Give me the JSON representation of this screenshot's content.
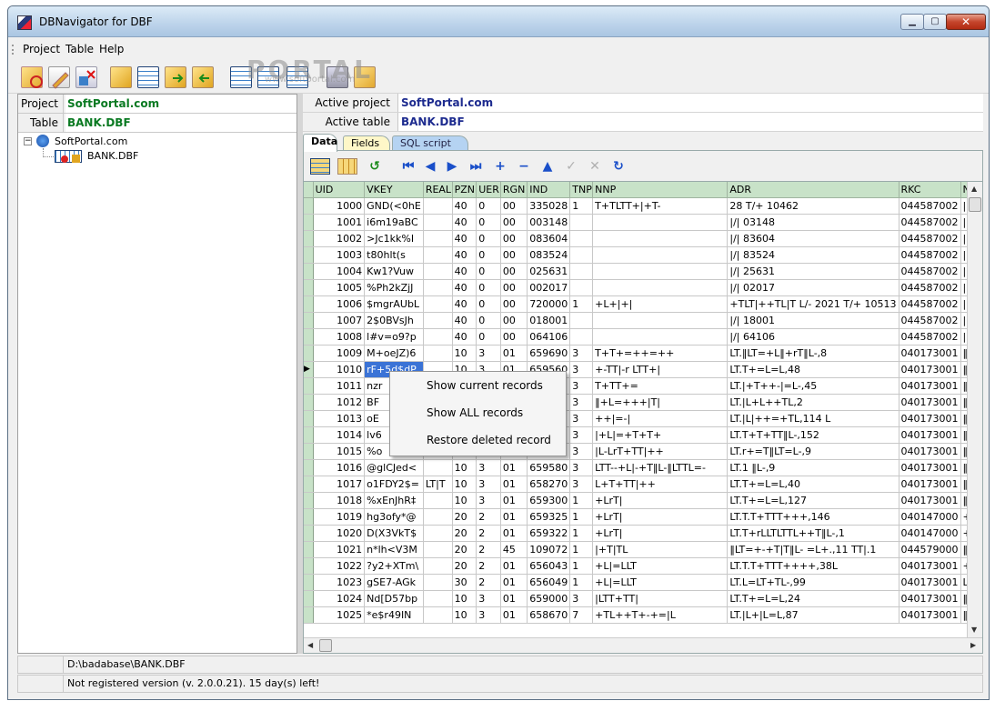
{
  "window": {
    "title": "DBNavigator for DBF"
  },
  "menu": [
    "Project",
    "Table",
    "Help"
  ],
  "watermark": {
    "big": "PORTAL",
    "small": "www.softportal.com"
  },
  "left": {
    "project_label": "Project",
    "project_value": "SoftPortal.com",
    "table_label": "Table",
    "table_value": "BANK.DBF",
    "tree": {
      "root": "SoftPortal.com",
      "child": "BANK.DBF"
    }
  },
  "right": {
    "active_project_label": "Active project",
    "active_project_value": "SoftPortal.com",
    "active_table_label": "Active table",
    "active_table_value": "BANK.DBF",
    "tabs": [
      "Data",
      "Fields",
      "SQL script"
    ]
  },
  "grid": {
    "columns": [
      "UID",
      "VKEY",
      "REAL",
      "PZN",
      "UER",
      "RGN",
      "IND",
      "TNP",
      "NNP",
      "ADR",
      "RKC",
      "NA"
    ],
    "rows": [
      [
        "1000",
        "GND(<0hE",
        "",
        "40",
        "0",
        "00",
        "335028",
        "1",
        "T+TLTT+|+T-",
        "28 T/+ 10462",
        "044587002",
        "|L"
      ],
      [
        "1001",
        "i6m19aBC",
        "",
        "40",
        "0",
        "00",
        "003148",
        "",
        "",
        "|/| 03148",
        "044587002",
        "|L"
      ],
      [
        "1002",
        ">Jc1kk%I",
        "",
        "40",
        "0",
        "00",
        "083604",
        "",
        "",
        "|/| 83604",
        "044587002",
        "|L"
      ],
      [
        "1003",
        "t80hlt(s",
        "",
        "40",
        "0",
        "00",
        "083524",
        "",
        "",
        "|/| 83524",
        "044587002",
        "|L"
      ],
      [
        "1004",
        "Kw1?Vuw",
        "",
        "40",
        "0",
        "00",
        "025631",
        "",
        "",
        "|/| 25631",
        "044587002",
        "|L"
      ],
      [
        "1005",
        "%Ph2kZjJ",
        "",
        "40",
        "0",
        "00",
        "002017",
        "",
        "",
        "|/| 02017",
        "044587002",
        "|L"
      ],
      [
        "1006",
        "$mgrAUbL",
        "",
        "40",
        "0",
        "00",
        "720000",
        "1",
        "+L+|+|",
        "+TLT|++TL|T L/- 2021 T/+ 10513",
        "044587002",
        "|L"
      ],
      [
        "1007",
        "2$0BVsJh",
        "",
        "40",
        "0",
        "00",
        "018001",
        "",
        "",
        "|/| 18001",
        "044587002",
        "|L"
      ],
      [
        "1008",
        "l#v=o9?p",
        "",
        "40",
        "0",
        "00",
        "064106",
        "",
        "",
        "|/| 64106",
        "044587002",
        "|L"
      ],
      [
        "1009",
        "M+oeJZ)6",
        "",
        "10",
        "3",
        "01",
        "659690",
        "3",
        "T+T+=++=++",
        "LT.‖LT=+L‖+rT‖L-,8",
        "040173001",
        "‖r"
      ],
      [
        "1010",
        "rF+5d$dP",
        "",
        "10",
        "3",
        "01",
        "659560",
        "3",
        "+-TT|-r LTT+|",
        "LT.T+=L=L,48",
        "040173001",
        "‖r"
      ],
      [
        "1011",
        "nzr",
        "",
        "",
        "",
        "",
        "",
        "3",
        "T+TT+=",
        "LT.|+T++-|=L-,45",
        "040173001",
        "‖r"
      ],
      [
        "1012",
        "BF",
        "",
        "",
        "",
        "",
        "",
        "3",
        "‖+L=+++|T|",
        "LT.|L+L++TL,2",
        "040173001",
        "‖r"
      ],
      [
        "1013",
        "oE",
        "",
        "",
        "",
        "",
        "",
        "3",
        "++|=-|",
        "LT.|L|++=+TL,114 L",
        "040173001",
        "‖r"
      ],
      [
        "1014",
        "lv6",
        "",
        "",
        "",
        "",
        "",
        "3",
        "|+L|=+T+T+",
        "LT.T+T+TT‖L-,152",
        "040173001",
        "‖r"
      ],
      [
        "1015",
        "%o",
        "",
        "",
        "",
        "",
        "",
        "3",
        "|L-LrT+TT|++",
        "LT.r+=T‖LT=L-,9",
        "040173001",
        "‖r"
      ],
      [
        "1016",
        "@glCJed<",
        "",
        "10",
        "3",
        "01",
        "659580",
        "3",
        "LTT--+L|-+T‖L-‖LTTL=-",
        "LT.1 ‖L-,9",
        "040173001",
        "‖r"
      ],
      [
        "1017",
        "o1FDY2$=",
        "LT|T",
        "10",
        "3",
        "01",
        "658270",
        "3",
        "L+T+TT|++",
        "LT.T+=L=L,40",
        "040173001",
        "‖r"
      ],
      [
        "1018",
        "%xEnJhR‡",
        "",
        "10",
        "3",
        "01",
        "659300",
        "1",
        "+LrT|",
        "LT.T+=L=L,127",
        "040173001",
        "‖r"
      ],
      [
        "1019",
        "hg3ofy*@",
        "",
        "20",
        "2",
        "01",
        "659325",
        "1",
        "+LrT|",
        "LT.T.T+TTT+++,146",
        "040147000",
        "+L"
      ],
      [
        "1020",
        "D(X3VkT$",
        "",
        "20",
        "2",
        "01",
        "659322",
        "1",
        "+LrT|",
        "LT.T+rLLTLTTL++T‖L-,1",
        "040147000",
        "+L"
      ],
      [
        "1021",
        "n*lh<V3M",
        "",
        "20",
        "2",
        "45",
        "109072",
        "1",
        "|+T|TL",
        "‖LT=+-+T|T‖L- =L+.,11 TT|.1",
        "044579000",
        "‖L-"
      ],
      [
        "1022",
        "?y2+XTm\\",
        "",
        "20",
        "2",
        "01",
        "656043",
        "1",
        "+L|=LLT",
        "LT.T.T+TTT++++,38L",
        "040173001",
        "++"
      ],
      [
        "1023",
        "gSE7-AGk",
        "",
        "30",
        "2",
        "01",
        "656049",
        "1",
        "+L|=LLT",
        "LT.L=LT+TL-,99",
        "040173001",
        "LL"
      ],
      [
        "1024",
        "Nd[D57bp",
        "",
        "10",
        "3",
        "01",
        "659000",
        "3",
        "|LTT+TT|",
        "LT.T+=L=L,24",
        "040173001",
        "‖r"
      ],
      [
        "1025",
        "*e$r49IN",
        "",
        "10",
        "3",
        "01",
        "658670",
        "7",
        "+TL++T+-+=|L",
        "LT.|L+|L=L,87",
        "040173001",
        "‖r"
      ]
    ]
  },
  "context_menu": [
    "Show current records",
    "Show ALL records",
    "Restore deleted record"
  ],
  "status": {
    "path": "D:\\badabase\\BANK.DBF",
    "message": "Not registered version (v. 2.0.0.21). 15 day(s) left!"
  }
}
